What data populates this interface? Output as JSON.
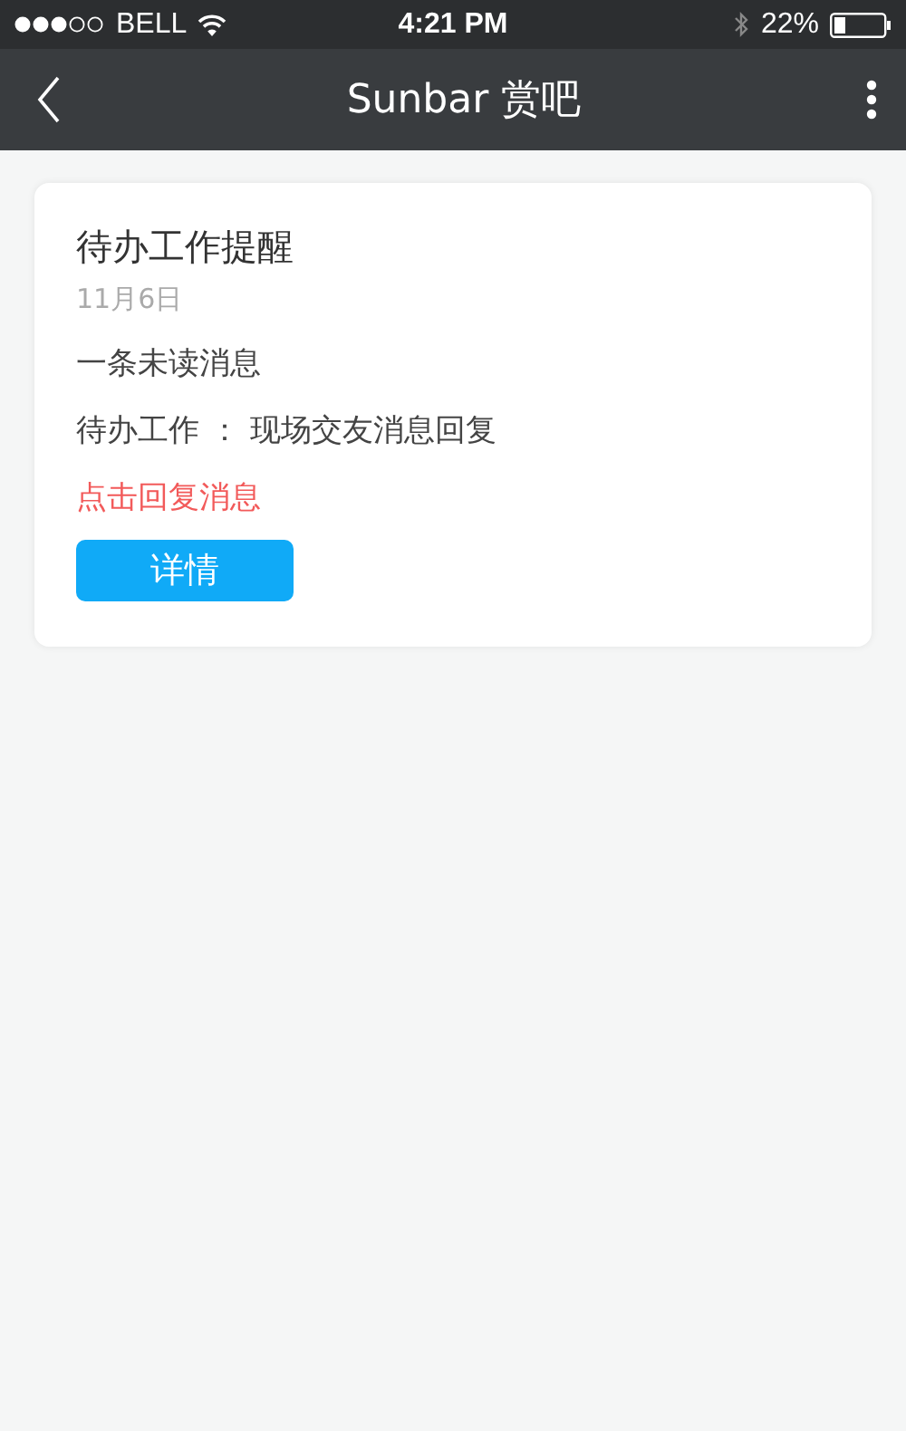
{
  "status_bar": {
    "carrier": "BELL",
    "time": "4:21 PM",
    "battery": "22%"
  },
  "nav_bar": {
    "title": "Sunbar 赏吧"
  },
  "card": {
    "title": "待办工作提醒",
    "date": "11月6日",
    "lines": [
      {
        "kind": "plain",
        "text": "一条未读消息"
      },
      {
        "kind": "plain",
        "text": "待办工作 ： 现场交友消息回复"
      },
      {
        "kind": "link",
        "text": "点击回复消息"
      }
    ],
    "button": "详情"
  }
}
